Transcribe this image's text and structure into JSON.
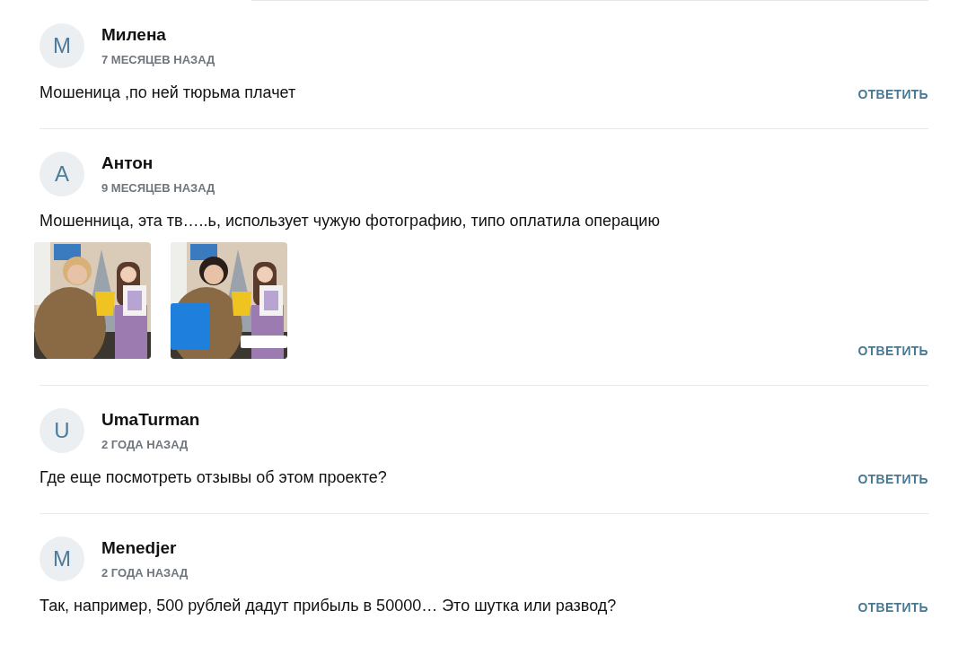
{
  "comments": [
    {
      "avatar": "M",
      "author": "Милена",
      "time": "7 МЕСЯЦЕВ НАЗАД",
      "text": "Мошеница ,по ней тюрьма плачет",
      "reply": "ОТВЕТИТЬ"
    },
    {
      "avatar": "А",
      "author": "Антон",
      "time": "9 МЕСЯЦЕВ НАЗАД",
      "text": "Мошенница, эта тв…..ь, использует чужую фотографию, типо оплатила операцию",
      "reply": "ОТВЕТИТЬ"
    },
    {
      "avatar": "U",
      "author": "UmaTurman",
      "time": "2 ГОДА НАЗАД",
      "text": "Где еще посмотреть отзывы об этом проекте?",
      "reply": "ОТВЕТИТЬ"
    },
    {
      "avatar": "M",
      "author": "Menedjer",
      "time": "2 ГОДА НАЗАД",
      "text": "Так, например, 500 рублей дадут прибыль в 50000… Это шутка или развод?",
      "reply": "ОТВЕТИТЬ"
    }
  ]
}
